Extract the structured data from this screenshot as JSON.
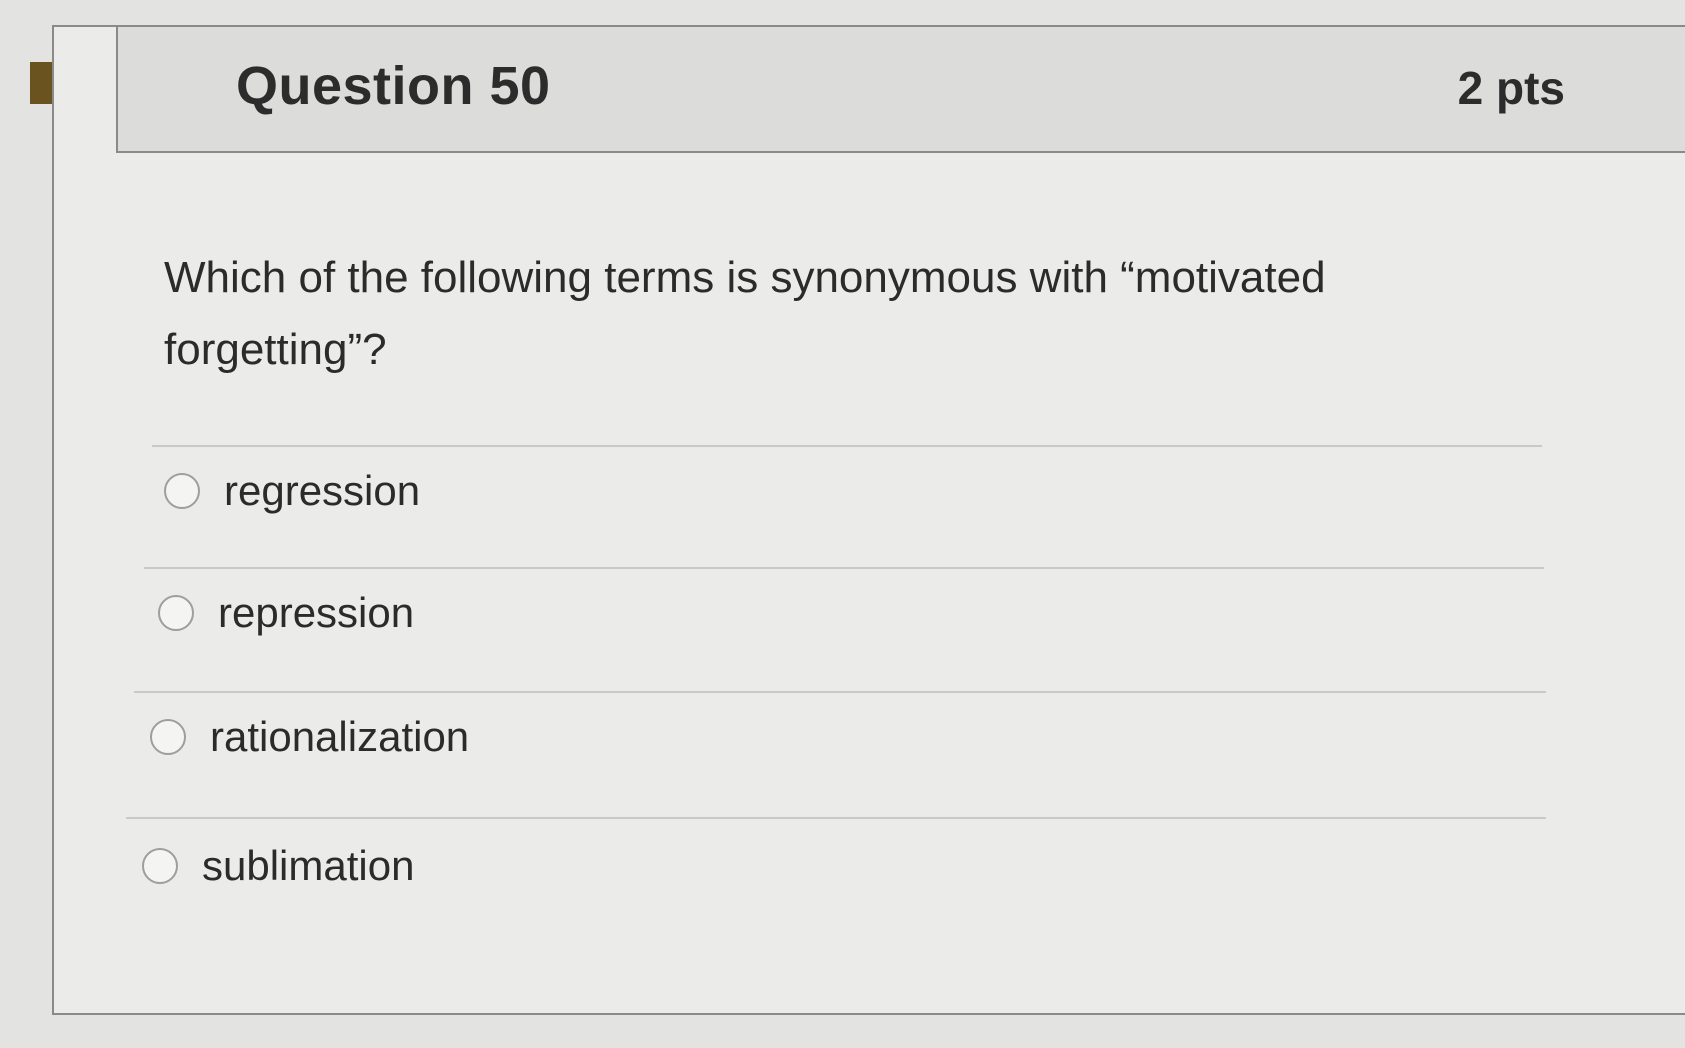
{
  "question": {
    "title": "Question 50",
    "points": "2 pts",
    "text": "Which of the following terms is synonymous with “motivated forgetting”?",
    "flag_icon": "bookmark-flag-icon",
    "flag_color": "#6b531f"
  },
  "answers": [
    {
      "label": "regression",
      "selected": false
    },
    {
      "label": "repression",
      "selected": false
    },
    {
      "label": "rationalization",
      "selected": false
    },
    {
      "label": "sublimation",
      "selected": false
    }
  ]
}
